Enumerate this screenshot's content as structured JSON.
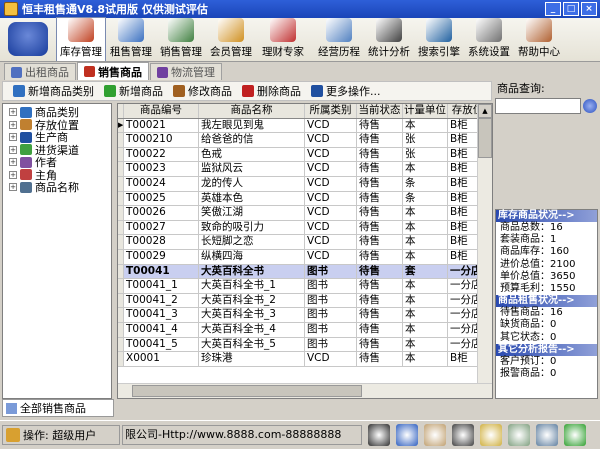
{
  "window": {
    "title": "恒丰租售通V8.8试用版 仅供测试评估"
  },
  "toolbar": {
    "buttons": [
      {
        "label": "库存管理",
        "active": true,
        "icon": "house-icon",
        "color": "#c04020"
      },
      {
        "label": "租售管理",
        "active": false,
        "icon": "box-icon",
        "color": "#3a70c0"
      },
      {
        "label": "销售管理",
        "active": false,
        "icon": "chart-icon",
        "color": "#408040"
      },
      {
        "label": "会员管理",
        "active": false,
        "icon": "people-icon",
        "color": "#d09020"
      },
      {
        "label": "理财专家",
        "active": false,
        "icon": "money-icon",
        "color": "#c03030"
      },
      {
        "label": "经营历程",
        "active": false,
        "icon": "calendar-icon",
        "color": "#5080c0"
      },
      {
        "label": "统计分析",
        "active": false,
        "icon": "monitor-icon",
        "color": "#404040"
      },
      {
        "label": "搜索引擎",
        "active": false,
        "icon": "search-icon",
        "color": "#2060a0"
      },
      {
        "label": "系统设置",
        "active": false,
        "icon": "tools-icon",
        "color": "#707070"
      },
      {
        "label": "帮助中心",
        "active": false,
        "icon": "help-icon",
        "color": "#b06030"
      }
    ]
  },
  "tabs": [
    {
      "label": "出租商品",
      "active": false,
      "color": "#5070c0"
    },
    {
      "label": "销售商品",
      "active": true,
      "color": "#c03020"
    },
    {
      "label": "物流管理",
      "active": false,
      "color": "#7040a0"
    }
  ],
  "actions": [
    {
      "label": "新增商品类别",
      "color": "#3070c0"
    },
    {
      "label": "新增商品",
      "color": "#30a030"
    },
    {
      "label": "修改商品",
      "color": "#a06020"
    },
    {
      "label": "删除商品",
      "color": "#c02020"
    },
    {
      "label": "更多操作...",
      "color": "#2050a0"
    }
  ],
  "tree": [
    {
      "label": "商品类别",
      "color": "#3070c0",
      "expander": "+"
    },
    {
      "label": "存放位置",
      "color": "#c08030",
      "expander": "+"
    },
    {
      "label": "生产商",
      "color": "#2050a0",
      "expander": "+"
    },
    {
      "label": "进货渠道",
      "color": "#40a040",
      "expander": "+"
    },
    {
      "label": "作者",
      "color": "#8050a0",
      "expander": "+"
    },
    {
      "label": "主角",
      "color": "#c04040",
      "expander": "+"
    },
    {
      "label": "商品名称",
      "color": "#507090",
      "expander": "+"
    }
  ],
  "grid": {
    "headers": [
      "商品编号",
      "商品名称",
      "所属类别",
      "当前状态",
      "计量单位",
      "存放位"
    ],
    "rows": [
      {
        "cells": [
          "T00021",
          "我左眼见到鬼",
          "VCD",
          "待售",
          "本",
          "B柜"
        ],
        "selected": false,
        "indicator": "▶"
      },
      {
        "cells": [
          "T000210",
          "给爸爸的信",
          "VCD",
          "待售",
          "张",
          "B柜"
        ],
        "selected": false,
        "indicator": ""
      },
      {
        "cells": [
          "T00022",
          "色戒",
          "VCD",
          "待售",
          "张",
          "B柜"
        ],
        "selected": false,
        "indicator": ""
      },
      {
        "cells": [
          "T00023",
          "监狱风云",
          "VCD",
          "待售",
          "本",
          "B柜"
        ],
        "selected": false,
        "indicator": ""
      },
      {
        "cells": [
          "T00024",
          "龙的传人",
          "VCD",
          "待售",
          "条",
          "B柜"
        ],
        "selected": false,
        "indicator": ""
      },
      {
        "cells": [
          "T00025",
          "英雄本色",
          "VCD",
          "待售",
          "条",
          "B柜"
        ],
        "selected": false,
        "indicator": ""
      },
      {
        "cells": [
          "T00026",
          "笑傲江湖",
          "VCD",
          "待售",
          "本",
          "B柜"
        ],
        "selected": false,
        "indicator": ""
      },
      {
        "cells": [
          "T00027",
          "致命的吸引力",
          "VCD",
          "待售",
          "本",
          "B柜"
        ],
        "selected": false,
        "indicator": ""
      },
      {
        "cells": [
          "T00028",
          "长短脚之恋",
          "VCD",
          "待售",
          "本",
          "B柜"
        ],
        "selected": false,
        "indicator": ""
      },
      {
        "cells": [
          "T00029",
          "纵横四海",
          "VCD",
          "待售",
          "本",
          "B柜"
        ],
        "selected": false,
        "indicator": ""
      },
      {
        "cells": [
          "T00041",
          "大英百科全书",
          "图书",
          "待售",
          "套",
          "一分店"
        ],
        "selected": true,
        "indicator": ""
      },
      {
        "cells": [
          "T00041_1",
          "大英百科全书_1",
          "图书",
          "待售",
          "本",
          "一分店"
        ],
        "selected": false,
        "indicator": ""
      },
      {
        "cells": [
          "T00041_2",
          "大英百科全书_2",
          "图书",
          "待售",
          "本",
          "一分店"
        ],
        "selected": false,
        "indicator": ""
      },
      {
        "cells": [
          "T00041_3",
          "大英百科全书_3",
          "图书",
          "待售",
          "本",
          "一分店"
        ],
        "selected": false,
        "indicator": ""
      },
      {
        "cells": [
          "T00041_4",
          "大英百科全书_4",
          "图书",
          "待售",
          "本",
          "一分店"
        ],
        "selected": false,
        "indicator": ""
      },
      {
        "cells": [
          "T00041_5",
          "大英百科全书_5",
          "图书",
          "待售",
          "本",
          "一分店"
        ],
        "selected": false,
        "indicator": ""
      },
      {
        "cells": [
          "X0001",
          "珍珠港",
          "VCD",
          "待售",
          "本",
          "B柜"
        ],
        "selected": false,
        "indicator": ""
      }
    ]
  },
  "search": {
    "label": "商品查询:",
    "value": ""
  },
  "panel": {
    "section1_title": "库存商品状况-->",
    "section1": [
      "商品总数：16",
      "套装商品：1",
      "商品库存：160",
      "进价总值：2100",
      "单价总值：3650",
      "预算毛利：1550"
    ],
    "section2_title": "商品租售状况-->",
    "section2": [
      "待售商品：16",
      "缺货商品：0",
      "其它状态：0"
    ],
    "section3_title": "其它分析报告-->",
    "section3": [
      "客户预订：0",
      "报警商品：0"
    ]
  },
  "bottom_tab": {
    "label": "全部销售商品"
  },
  "status": {
    "operator": "操作: 超级用户",
    "company": "限公司-Http://www.8888.com-88888888"
  },
  "status_icons": [
    {
      "name": "person-icon",
      "color": "#303030"
    },
    {
      "name": "ie-icon",
      "color": "#3060c0"
    },
    {
      "name": "face-icon",
      "color": "#c0a070"
    },
    {
      "name": "film-icon",
      "color": "#404040"
    },
    {
      "name": "doc-icon",
      "color": "#d0b040"
    },
    {
      "name": "tool-icon",
      "color": "#80a080"
    },
    {
      "name": "printer-icon",
      "color": "#6080a0"
    },
    {
      "name": "exit-icon",
      "color": "#30a030"
    }
  ]
}
